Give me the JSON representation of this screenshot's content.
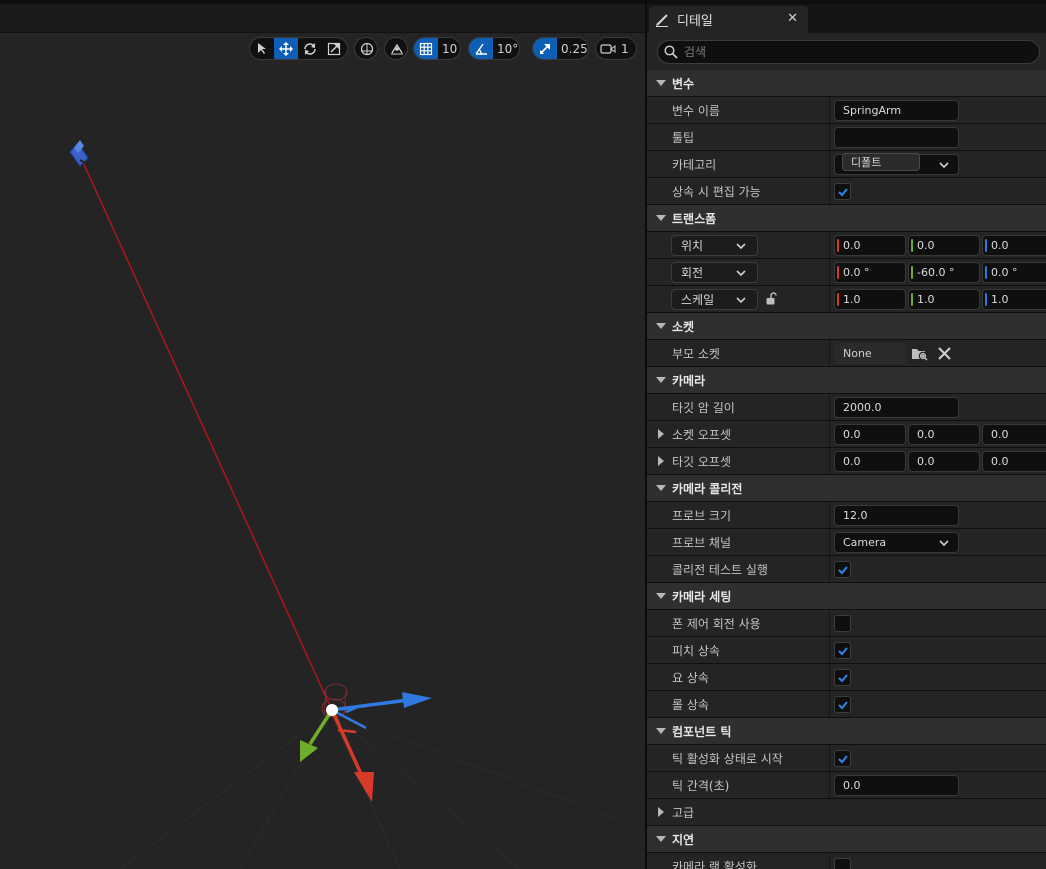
{
  "viewport_toolbar": {
    "grid_snap": "10",
    "rotation_snap": "10°",
    "scale_snap": "0.25",
    "camera_speed": "1"
  },
  "details": {
    "tab_title": "디테일",
    "search_placeholder": "검색",
    "variable": {
      "header": "변수",
      "name_label": "변수 이름",
      "name_value": "SpringArm",
      "tooltip_label": "툴팁",
      "tooltip_value": "",
      "category_label": "카테고리",
      "category_value": "디폴트",
      "editable_label": "상속 시 편집 가능",
      "editable_checked": true
    },
    "transform": {
      "header": "트랜스폼",
      "location_label": "위치",
      "location": [
        "0.0",
        "0.0",
        "0.0"
      ],
      "rotation_label": "회전",
      "rotation": [
        "0.0 °",
        "-60.0 °",
        "0.0 °"
      ],
      "scale_label": "스케일",
      "scale": [
        "1.0",
        "1.0",
        "1.0"
      ]
    },
    "sockets": {
      "header": "소켓",
      "parent_socket_label": "부모 소켓",
      "parent_socket_value": "None"
    },
    "camera": {
      "header": "카메라",
      "target_arm_length_label": "타깃 암 길이",
      "target_arm_length": "2000.0",
      "socket_offset_label": "소켓 오프셋",
      "socket_offset": [
        "0.0",
        "0.0",
        "0.0"
      ],
      "target_offset_label": "타깃 오프셋",
      "target_offset": [
        "0.0",
        "0.0",
        "0.0"
      ]
    },
    "camera_collision": {
      "header": "카메라 콜리전",
      "probe_size_label": "프로브 크기",
      "probe_size": "12.0",
      "probe_channel_label": "프로브 채널",
      "probe_channel": "Camera",
      "do_collision_test_label": "콜리전 테스트 실행",
      "do_collision_test": true
    },
    "camera_settings": {
      "header": "카메라 세팅",
      "use_pawn_control_rotation_label": "폰 제어 회전 사용",
      "use_pawn_control_rotation": false,
      "inherit_pitch_label": "피치 상속",
      "inherit_pitch": true,
      "inherit_yaw_label": "요 상속",
      "inherit_yaw": true,
      "inherit_roll_label": "롤 상속",
      "inherit_roll": true
    },
    "component_tick": {
      "header": "컴포넌트 틱",
      "start_with_tick_enabled_label": "틱 활성화 상태로 시작",
      "start_with_tick_enabled": true,
      "tick_interval_label": "틱 간격(초)",
      "tick_interval": "0.0"
    },
    "advanced": {
      "header": "고급"
    },
    "lag": {
      "header": "지연",
      "enable_camera_lag_label": "카메라 랙 활성화",
      "enable_camera_lag": false
    }
  },
  "colors": {
    "accent_blue": "#0d5fb5",
    "axis_x": "#d83a2a",
    "axis_y": "#6fae2a",
    "axis_z": "#2f79e0",
    "panel_bg": "#242424",
    "viewport_bg": "#242424"
  }
}
